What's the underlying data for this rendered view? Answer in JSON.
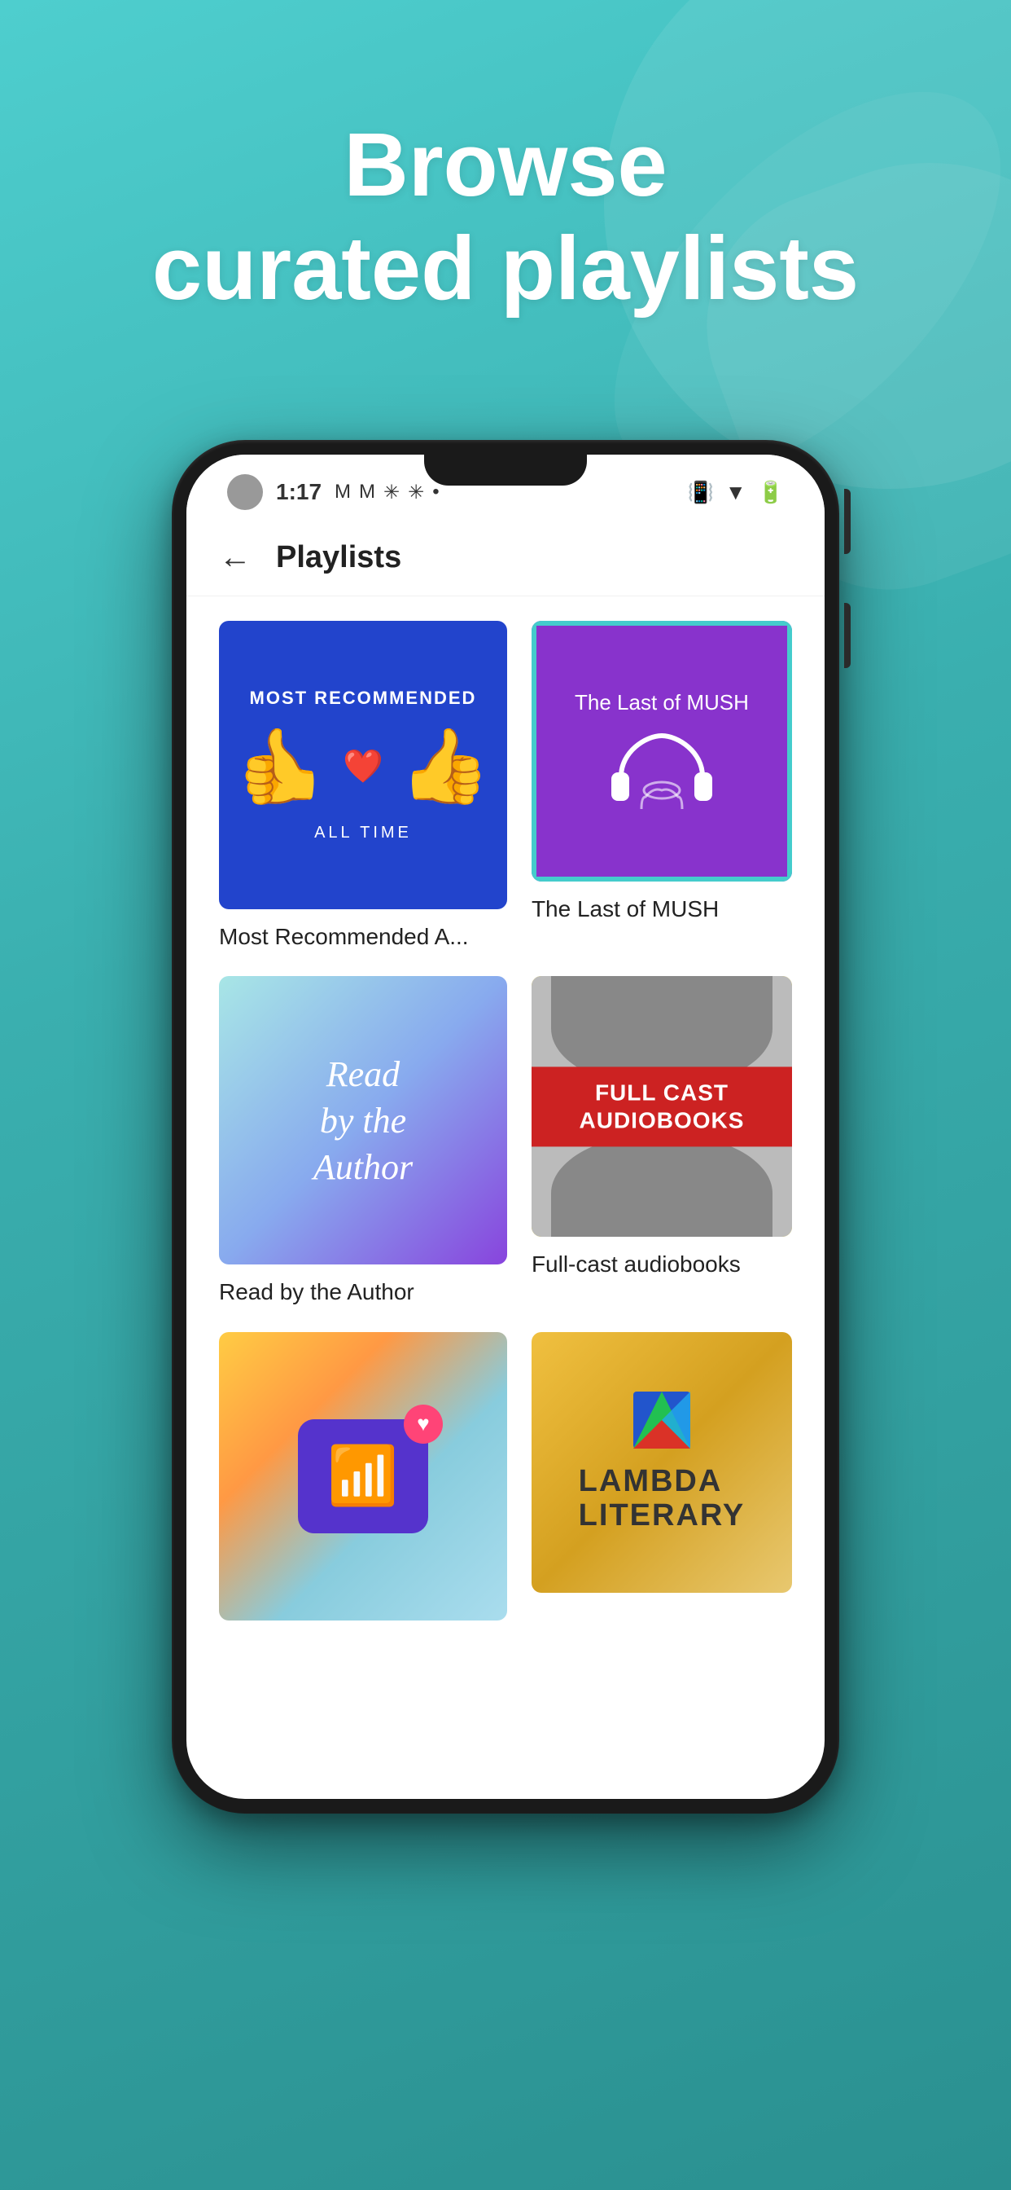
{
  "page": {
    "background_color": "#3dbfbf",
    "headline_line1": "Browse",
    "headline_line2": "curated playlists"
  },
  "status_bar": {
    "time": "1:17",
    "icons": "M M ❋ ❋ •",
    "right_icons": "🔔 ▼ 🔋"
  },
  "screen": {
    "title": "Playlists",
    "back_label": "←"
  },
  "playlists": [
    {
      "id": "most-recommended",
      "label": "Most Recommended A...",
      "cover_type": "most-recommended"
    },
    {
      "id": "last-of-mush",
      "label": "The Last of MUSH",
      "cover_type": "mush",
      "cover_title": "The Last of MUSH"
    },
    {
      "id": "read-by-author",
      "label": "Read by the Author",
      "cover_type": "read-author",
      "cover_text": "Read\nby the\nAuthor"
    },
    {
      "id": "full-cast",
      "label": "Full-cast audiobooks",
      "cover_type": "fullcast",
      "cover_text": "FULL\nCAST\nAUDIOBOOKS"
    },
    {
      "id": "podcast",
      "label": "",
      "cover_type": "podcast"
    },
    {
      "id": "lambda",
      "label": "",
      "cover_type": "lambda",
      "name_line1": "LAMBDA",
      "name_line2": "LITERARY"
    }
  ]
}
